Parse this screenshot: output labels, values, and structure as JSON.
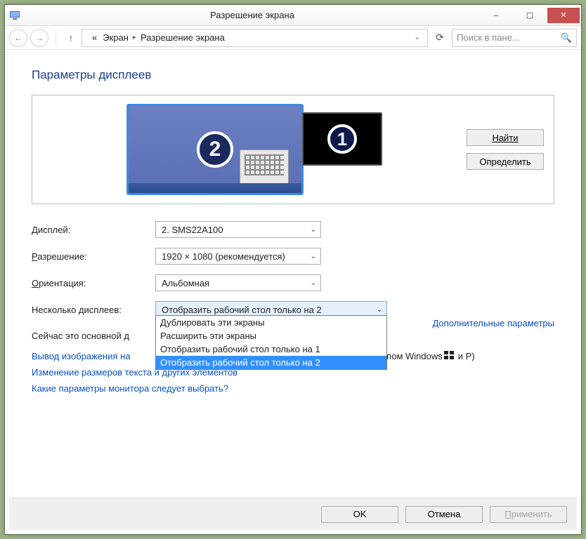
{
  "window": {
    "title": "Разрешение экрана",
    "minimize": "–",
    "maximize": "▢",
    "close": "✕"
  },
  "nav": {
    "back": "←",
    "forward": "→",
    "up": "↑",
    "chevrons": "«",
    "crumb1": "Экран",
    "crumb_sep": "▸",
    "crumb2": "Разрешение экрана",
    "dd": "⌄",
    "refresh": "⟳",
    "search_placeholder": "Поиск в пане...",
    "search_icon": "🔍"
  },
  "heading": "Параметры дисплеев",
  "preview": {
    "monitor2_num": "2",
    "monitor1_num": "1",
    "detect": "Найти",
    "identify": "Определить"
  },
  "form": {
    "display_label_pre": "Д",
    "display_label_post": "исплей:",
    "display_value": "2. SMS22A100",
    "resolution_label_pre": "Р",
    "resolution_label_post": "азрешение:",
    "resolution_value": "1920 × 1080 (рекомендуется)",
    "orientation_label_pre": "О",
    "orientation_label_post": "риентация:",
    "orientation_value": "Альбомная",
    "multi_label": "Несколько дисплеев:",
    "multi_value": "Отобразить рабочий стол только на 2",
    "multi_arr": "⌄",
    "multi_options": [
      "Дублировать эти экраны",
      "Расширить эти экраны",
      "Отобразить рабочий стол только на 1",
      "Отобразить рабочий стол только на 2"
    ]
  },
  "note": "Сейчас это основной д",
  "advanced": "Дополнительные параметры",
  "links": {
    "hint_a": "Вывод изображения на",
    "hint_b": "готипом Windows",
    "hint_c": "и P)",
    "text_size": "Изменение размеров текста и других элементов",
    "which_mon": "Какие параметры монитора следует выбрать?"
  },
  "footer": {
    "ok": "OK",
    "cancel": "Отмена",
    "apply": "Применить"
  },
  "dd_arrow": "⌄"
}
